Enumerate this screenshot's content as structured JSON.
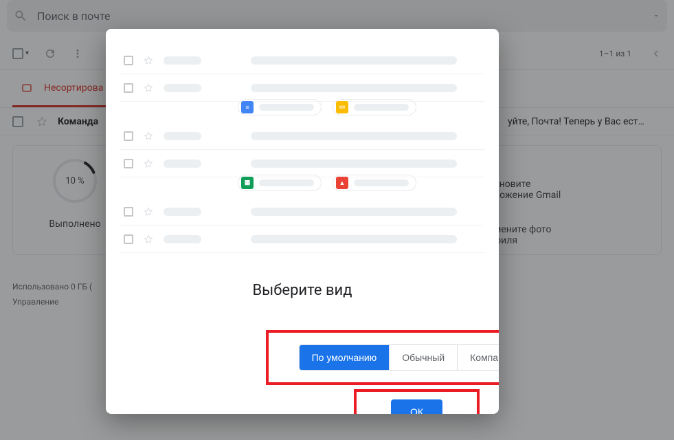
{
  "search": {
    "placeholder": "Поиск в почте"
  },
  "toolbar": {
    "pager": "1–1 из 1"
  },
  "tabs": {
    "primary_label": "Несортирова"
  },
  "mail": {
    "sender": "Команда",
    "snippet": "уйте, Почта! Теперь у Вас ест…"
  },
  "setup": {
    "progress_percent_label": "10 %",
    "progress_percent": 10,
    "done_label": "Выполнено",
    "hint_app_l1": "ановите",
    "hint_app_l2": "ложение Gmail",
    "hint_photo_l1": "мените фото",
    "hint_photo_l2": "филя"
  },
  "footer": {
    "storage_l1": "Использовано 0 ГБ (",
    "storage_l2": "Управление"
  },
  "modal": {
    "title": "Выберите вид",
    "option_default": "По умолчанию",
    "option_normal": "Обычный",
    "option_compact": "Компактный",
    "ok": "ОК",
    "chip_icons": {
      "docs": "#4285f4",
      "slides": "#fbbc04",
      "sheets": "#0f9d58",
      "image": "#ea4335"
    }
  }
}
